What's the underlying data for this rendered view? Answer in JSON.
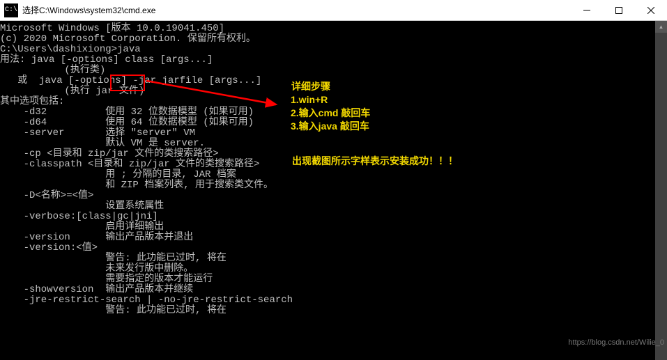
{
  "titlebar": {
    "icon_label": "C:\\",
    "title": "选择C:\\Windows\\system32\\cmd.exe"
  },
  "terminal": {
    "lines": [
      "Microsoft Windows [版本 10.0.19041.450]",
      "(c) 2020 Microsoft Corporation. 保留所有权利。",
      "",
      "C:\\Users\\dashixiong>java",
      "用法: java [-options] class [args...]",
      "           (执行类)",
      "   或  java [-options] -jar jarfile [args...]",
      "           (执行 jar 文件)",
      "其中选项包括:",
      "    -d32          使用 32 位数据模型 (如果可用)",
      "    -d64          使用 64 位数据模型 (如果可用)",
      "    -server       选择 \"server\" VM",
      "                  默认 VM 是 server.",
      "",
      "    -cp <目录和 zip/jar 文件的类搜索路径>",
      "    -classpath <目录和 zip/jar 文件的类搜索路径>",
      "                  用 ; 分隔的目录, JAR 档案",
      "                  和 ZIP 档案列表, 用于搜索类文件。",
      "    -D<名称>=<值>",
      "                  设置系统属性",
      "    -verbose:[class|gc|jni]",
      "                  启用详细输出",
      "    -version      输出产品版本并退出",
      "    -version:<值>",
      "                  警告: 此功能已过时, 将在",
      "                  未来发行版中删除。",
      "                  需要指定的版本才能运行",
      "    -showversion  输出产品版本并继续",
      "    -jre-restrict-search | -no-jre-restrict-search",
      "                  警告: 此功能已过时, 将在"
    ]
  },
  "annotations": {
    "steps_title": "详细步骤",
    "step1": "1.win+R",
    "step2": "2.输入cmd  敲回车",
    "step3": "3.输入java  敲回车",
    "success_msg": "出现截图所示字样表示安装成功！！！"
  },
  "watermark": "https://blog.csdn.net/Wilie_0"
}
